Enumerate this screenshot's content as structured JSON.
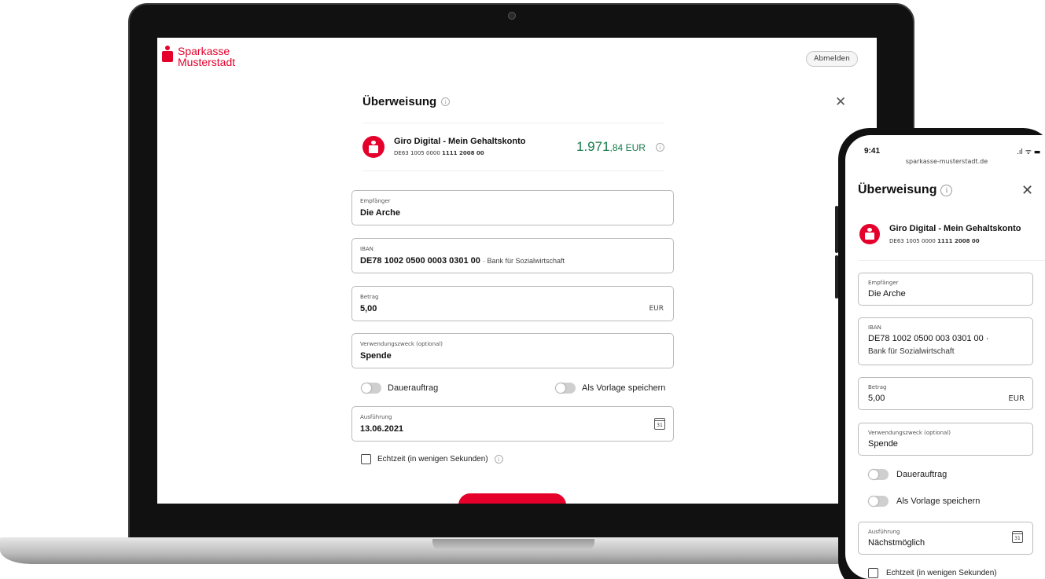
{
  "bank": {
    "name_line1": "Sparkasse",
    "name_line2": "Musterstadt",
    "brand_color": "#e4002b"
  },
  "desktop": {
    "logout_label": "Abmelden",
    "title": "Überweisung",
    "account": {
      "name": "Giro Digital - Mein Gehaltskonto",
      "iban_prefix": "DE63 1005 0000",
      "iban_bold": "1111 2008 00",
      "balance_main": "1.971",
      "balance_fraction": ",84 EUR",
      "balance_color": "#157a4a"
    },
    "fields": {
      "recipient": {
        "label": "Empfänger",
        "value": "Die Arche"
      },
      "iban": {
        "label": "IBAN",
        "value": "DE78 1002 0500 0003 0301 00",
        "bank": "·  Bank für Sozialwirtschaft"
      },
      "amount": {
        "label": "Betrag",
        "value": "5,00",
        "currency": "EUR"
      },
      "purpose": {
        "label": "Verwendungszweck (optional)",
        "value": "Spende"
      },
      "execution": {
        "label": "Ausführung",
        "value": "13.06.2021",
        "calendar_day": "31"
      }
    },
    "toggles": {
      "standing_order": "Dauerauftrag",
      "save_template": "Als Vorlage speichern"
    },
    "realtime_label": "Echtzeit (in wenigen Sekunden)",
    "info_glyph": "i"
  },
  "mobile": {
    "time": "9:41",
    "status_icons": "signal-wifi-battery",
    "status_text": ".ıl ᯤ ▬",
    "url": "sparkasse-musterstadt.de",
    "title": "Überweisung",
    "account": {
      "name": "Giro Digital - Mein Gehaltskonto",
      "iban_prefix": "DE63 1005 0000",
      "iban_bold": "1111 2008 00"
    },
    "fields": {
      "recipient": {
        "label": "Empfänger",
        "value": "Die Arche"
      },
      "iban": {
        "label": "IBAN",
        "value": "DE78 1002 0500 003 0301 00   ·",
        "bank": "Bank für Sozialwirtschaft"
      },
      "amount": {
        "label": "Betrag",
        "value": "5,00",
        "currency": "EUR"
      },
      "purpose": {
        "label": "Verwendungszweck (optional)",
        "value": "Spende"
      },
      "execution": {
        "label": "Ausführung",
        "value": "Nächstmöglich",
        "calendar_day": "31"
      }
    },
    "toggles": {
      "standing_order": "Dauerauftrag",
      "save_template": "Als Vorlage speichern"
    },
    "realtime_label": "Echtzeit (in wenigen Sekunden)"
  }
}
